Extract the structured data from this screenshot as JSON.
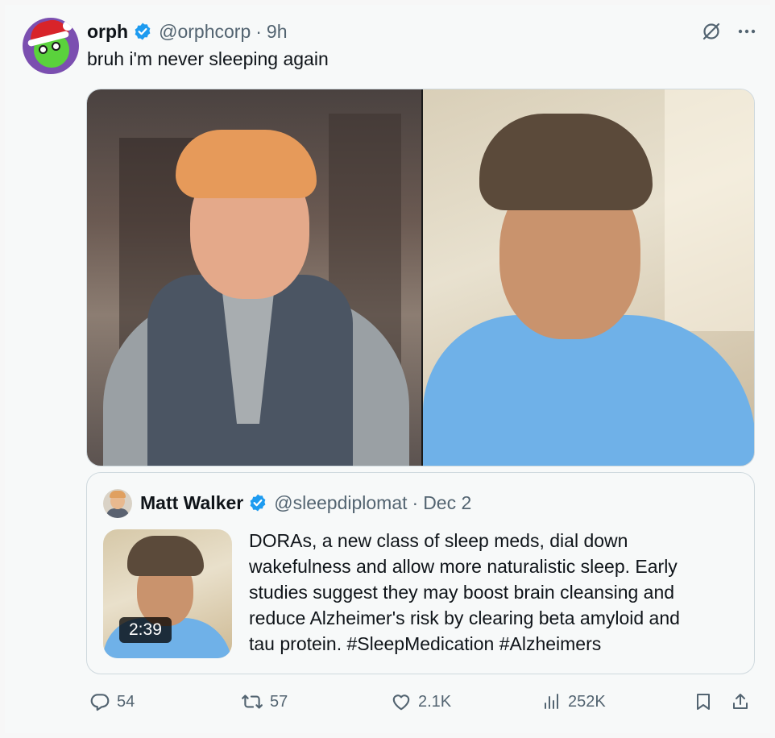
{
  "post": {
    "author_name": "orph",
    "author_handle": "@orphcorp",
    "separator": "·",
    "time": "9h",
    "text": "bruh i'm never sleeping again"
  },
  "quoted": {
    "author_name": "Matt Walker",
    "author_handle": "@sleepdiplomat",
    "separator": "·",
    "date": "Dec 2",
    "video_duration": "2:39",
    "text_lines": [
      "DORAs, a new class of sleep meds, dial down",
      "wakefulness and allow more naturalistic sleep. Early",
      "studies suggest they may boost brain cleansing and",
      "reduce Alzheimer's risk by clearing beta amyloid and",
      "tau protein. #SleepMedication #Alzheimers"
    ]
  },
  "actions": {
    "replies": "54",
    "reposts": "57",
    "likes": "2.1K",
    "views": "252K"
  },
  "icons": {
    "verified": "verified-badge-icon",
    "grok": "grok-icon",
    "more": "more-icon",
    "reply": "reply-icon",
    "repost": "repost-icon",
    "like": "heart-icon",
    "views": "views-icon",
    "bookmark": "bookmark-icon",
    "share": "share-icon"
  },
  "colors": {
    "verified": "#1d9bf0",
    "secondary_text": "#536471",
    "primary_text": "#0f1419",
    "border": "#cfd9de"
  }
}
